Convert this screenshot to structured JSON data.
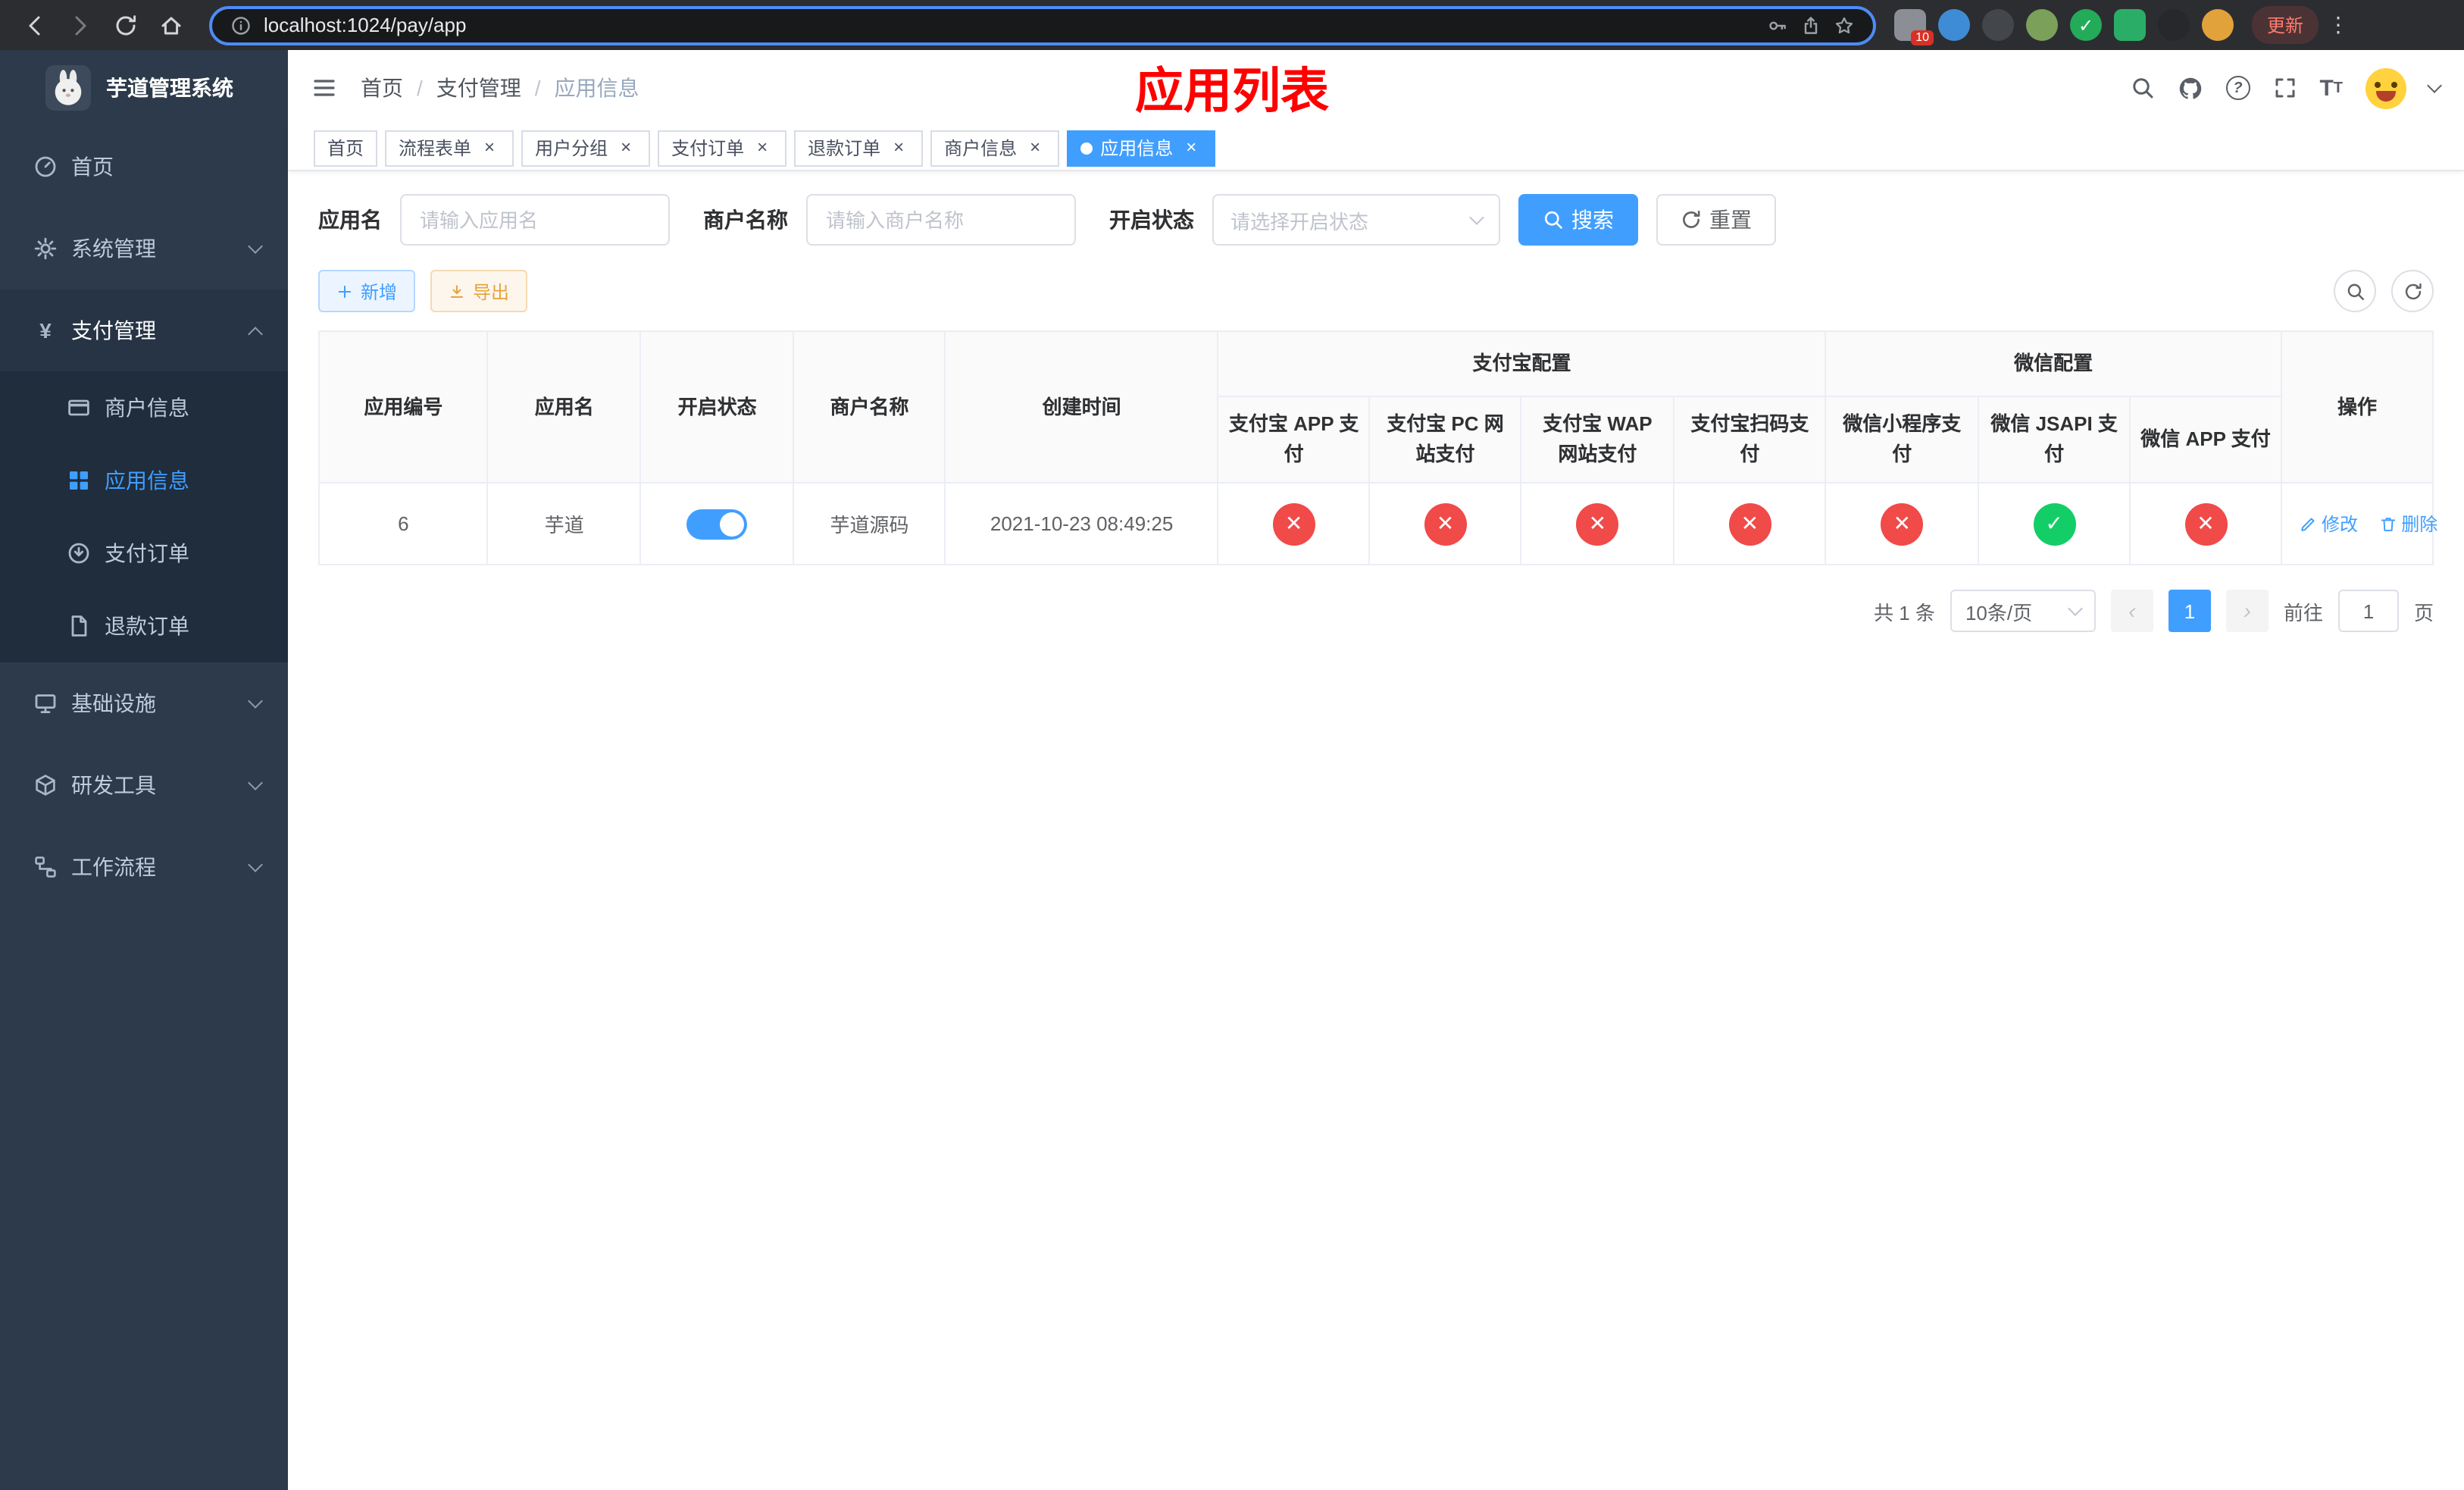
{
  "colors": {
    "accent": "#409eff",
    "success": "#13ce66",
    "danger": "#f04a49",
    "warning": "#e6a23c",
    "title_red": "#ff0000",
    "sidebar_bg": "#2d3a4b"
  },
  "icons": {
    "check_glyph": "✓",
    "cross_glyph": "✕"
  },
  "browser": {
    "url": "localhost:1024/pay/app",
    "update_label": "更新",
    "extension_badge": "10"
  },
  "sidebar": {
    "title": "芋道管理系统",
    "items": [
      {
        "label": "首页",
        "icon": "dashboard-icon"
      },
      {
        "label": "系统管理",
        "icon": "gear-icon",
        "chevron": "down"
      },
      {
        "label": "支付管理",
        "icon": "yen-icon",
        "chevron": "up",
        "expanded": true
      },
      {
        "label": "商户信息",
        "icon": "card-icon",
        "sub": true
      },
      {
        "label": "应用信息",
        "icon": "grid-icon",
        "sub": true,
        "active": true
      },
      {
        "label": "支付订单",
        "icon": "order-icon",
        "sub": true
      },
      {
        "label": "退款订单",
        "icon": "document-icon",
        "sub": true
      },
      {
        "label": "基础设施",
        "icon": "monitor-icon",
        "chevron": "down"
      },
      {
        "label": "研发工具",
        "icon": "cube-icon",
        "chevron": "down"
      },
      {
        "label": "工作流程",
        "icon": "flow-icon",
        "chevron": "down"
      }
    ]
  },
  "header": {
    "breadcrumb": [
      "首页",
      "支付管理",
      "应用信息"
    ],
    "title": "应用列表"
  },
  "tabs": [
    {
      "label": "首页",
      "closable": false,
      "active": false
    },
    {
      "label": "流程表单",
      "closable": true,
      "active": false
    },
    {
      "label": "用户分组",
      "closable": true,
      "active": false
    },
    {
      "label": "支付订单",
      "closable": true,
      "active": false
    },
    {
      "label": "退款订单",
      "closable": true,
      "active": false
    },
    {
      "label": "商户信息",
      "closable": true,
      "active": false
    },
    {
      "label": "应用信息",
      "closable": true,
      "active": true
    }
  ],
  "filters": {
    "app_name_label": "应用名",
    "app_name_placeholder": "请输入应用名",
    "merchant_label": "商户名称",
    "merchant_placeholder": "请输入商户名称",
    "status_label": "开启状态",
    "status_placeholder": "请选择开启状态",
    "search_label": "搜索",
    "reset_label": "重置"
  },
  "toolbar": {
    "add_label": "新增",
    "export_label": "导出"
  },
  "table": {
    "col_id": "应用编号",
    "col_name": "应用名",
    "col_status": "开启状态",
    "col_merchant": "商户名称",
    "col_created": "创建时间",
    "alipay_group": "支付宝配置",
    "wechat_group": "微信配置",
    "col_ops": "操作",
    "sub_cols": [
      "支付宝 APP 支付",
      "支付宝 PC 网站支付",
      "支付宝 WAP 网站支付",
      "支付宝扫码支付",
      "微信小程序支付",
      "微信 JSAPI 支付",
      "微信 APP 支付"
    ],
    "row": {
      "id": "6",
      "name": "芋道",
      "enabled": true,
      "merchant": "芋道源码",
      "created": "2021-10-23 08:49:25",
      "configs": [
        false,
        false,
        false,
        false,
        false,
        true,
        false
      ],
      "edit": "修改",
      "delete": "删除"
    }
  },
  "pagination": {
    "total": "共 1 条",
    "size": "10条/页",
    "page": "1",
    "goto": "前往",
    "goto_value": "1",
    "unit": "页"
  }
}
